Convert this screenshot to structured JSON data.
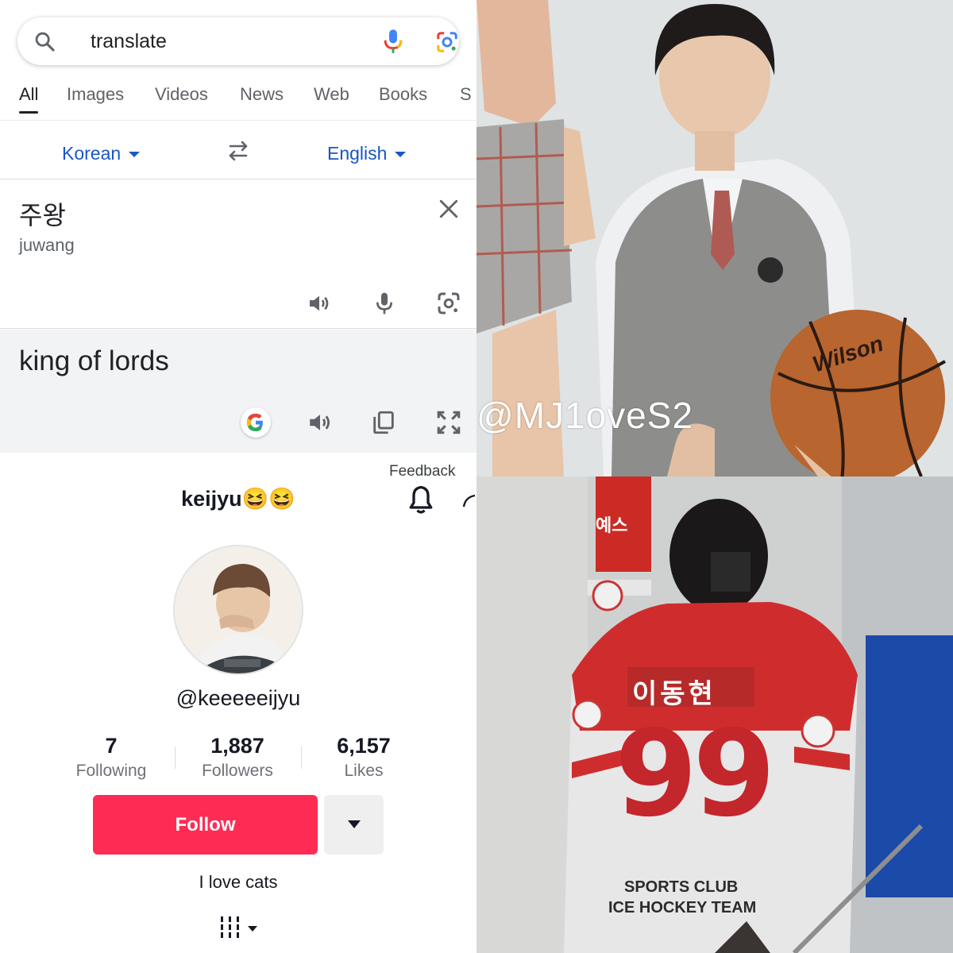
{
  "search": {
    "query": "translate"
  },
  "tabs": [
    "All",
    "Images",
    "Videos",
    "News",
    "Web",
    "Books",
    "S"
  ],
  "translate": {
    "source_lang": "Korean",
    "target_lang": "English",
    "source_text": "주왕",
    "source_romanization": "juwang",
    "output_text": "king of lords"
  },
  "feedback_label": "Feedback",
  "profile": {
    "display_name": "keijyu😆😆",
    "handle": "@keeeeeijyu",
    "stats": [
      {
        "value": "7",
        "label": "Following"
      },
      {
        "value": "1,887",
        "label": "Followers"
      },
      {
        "value": "6,157",
        "label": "Likes"
      }
    ],
    "follow_label": "Follow",
    "bio": "I love cats"
  },
  "photos": {
    "top_watermark": "@MJ1oveS2",
    "bottom_sign_text": "예스",
    "jersey_name": "이동현",
    "jersey_number": "99",
    "jersey_club": "SPORTS CLUB",
    "jersey_team": "ICE HOCKEY TEAM",
    "ball_brand": "Wilson"
  },
  "colors": {
    "google_blue": "#1a56c5",
    "tiktok_red": "#fe2c55"
  }
}
